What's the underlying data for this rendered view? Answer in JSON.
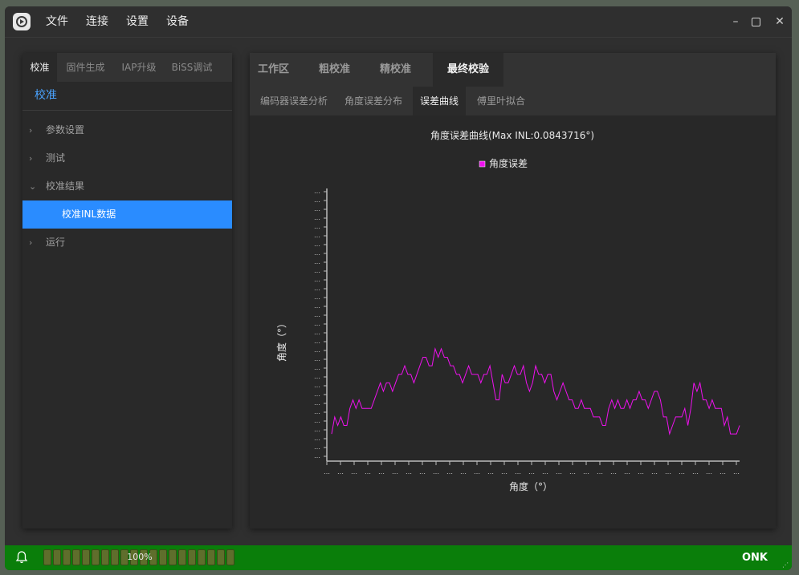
{
  "menu": [
    "文件",
    "连接",
    "设置",
    "设备"
  ],
  "window_controls": {
    "minimize": "–",
    "close": "✕"
  },
  "left_panel": {
    "tabs": [
      "校准",
      "固件生成",
      "IAP升级",
      "BiSS调试"
    ],
    "active_tab": "校准",
    "title": "校准",
    "tree": [
      {
        "label": "参数设置",
        "chevron": "›"
      },
      {
        "label": "测试",
        "chevron": "›"
      },
      {
        "label": "校准结果",
        "chevron": "⌄"
      },
      {
        "label": "校准INL数据",
        "chevron": ""
      },
      {
        "label": "运行",
        "chevron": "›"
      }
    ],
    "selected_item": "校准INL数据"
  },
  "right_panel": {
    "top_tabs": [
      "工作区",
      "粗校准",
      "精校准",
      "最终校验"
    ],
    "active_top_tab": "最终校验",
    "sub_tabs": [
      "编码器误差分析",
      "角度误差分布",
      "误差曲线",
      "傅里叶拟合"
    ],
    "active_sub_tab": "误差曲线"
  },
  "chart_data": {
    "type": "line",
    "title": "角度误差曲线(Max INL:0.0843716°)",
    "xlabel": "角度（°）",
    "ylabel": "角度（°）",
    "series": [
      {
        "name": "角度误差",
        "color": "#ee11ee",
        "values": [
          0.03,
          0.05,
          0.04,
          0.05,
          0.04,
          0.04,
          0.06,
          0.07,
          0.06,
          0.07,
          0.06,
          0.06,
          0.06,
          0.06,
          0.07,
          0.08,
          0.09,
          0.08,
          0.09,
          0.09,
          0.08,
          0.09,
          0.1,
          0.1,
          0.11,
          0.1,
          0.1,
          0.09,
          0.1,
          0.11,
          0.12,
          0.12,
          0.11,
          0.11,
          0.13,
          0.12,
          0.13,
          0.12,
          0.12,
          0.11,
          0.11,
          0.1,
          0.1,
          0.09,
          0.1,
          0.11,
          0.1,
          0.1,
          0.1,
          0.09,
          0.1,
          0.1,
          0.11,
          0.09,
          0.07,
          0.07,
          0.1,
          0.09,
          0.09,
          0.1,
          0.11,
          0.1,
          0.1,
          0.11,
          0.09,
          0.08,
          0.09,
          0.11,
          0.1,
          0.1,
          0.09,
          0.1,
          0.1,
          0.08,
          0.07,
          0.08,
          0.09,
          0.08,
          0.07,
          0.07,
          0.06,
          0.06,
          0.07,
          0.06,
          0.06,
          0.06,
          0.05,
          0.05,
          0.05,
          0.04,
          0.04,
          0.06,
          0.07,
          0.06,
          0.07,
          0.06,
          0.06,
          0.07,
          0.06,
          0.07,
          0.07,
          0.08,
          0.07,
          0.07,
          0.06,
          0.07,
          0.08,
          0.08,
          0.07,
          0.05,
          0.05,
          0.03,
          0.04,
          0.05,
          0.05,
          0.05,
          0.06,
          0.04,
          0.06,
          0.09,
          0.08,
          0.09,
          0.07,
          0.07,
          0.06,
          0.07,
          0.06,
          0.06,
          0.06,
          0.04,
          0.05,
          0.03,
          0.03,
          0.03,
          0.04
        ]
      }
    ],
    "legend": "top-center",
    "grid": false
  },
  "statusbar": {
    "progress_percent": 100,
    "progress_text": "100%",
    "right_text": "ONK",
    "bell_icon": "bell-icon"
  },
  "colors": {
    "accent": "#2a8cff",
    "series": "#ee11ee",
    "statusbar": "#0a7e0a"
  }
}
